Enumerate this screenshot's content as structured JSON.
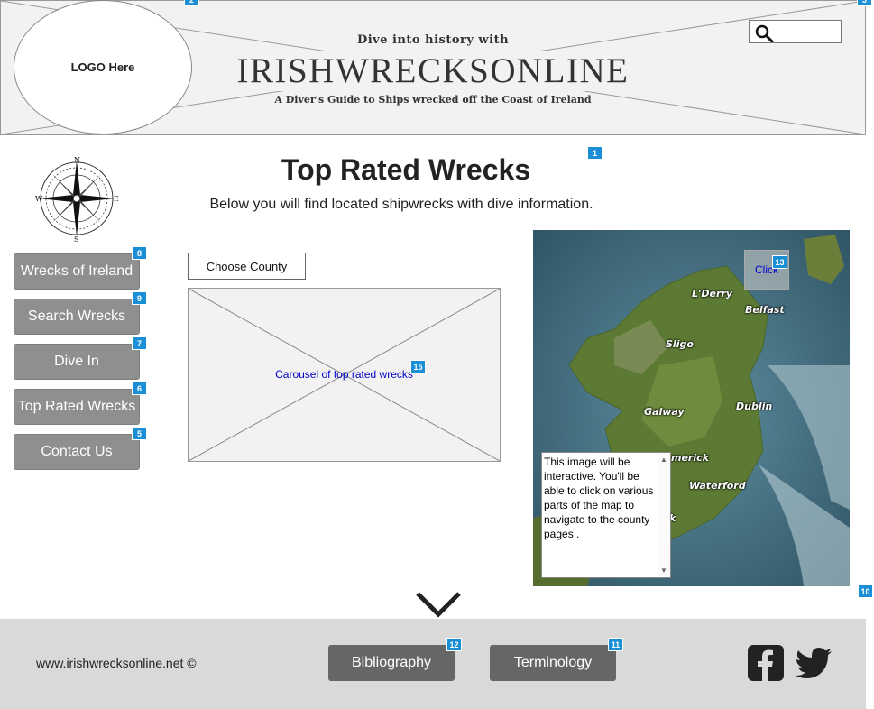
{
  "header": {
    "logo_text": "LOGO Here",
    "tagline_top": "Dive into history with",
    "site_title": "IRISHWRECKSONLINE",
    "tagline_bottom": "A Diver's Guide to Ships wrecked off the Coast of Ireland",
    "search_icon": "search-icon"
  },
  "badges": {
    "header_logo": "2",
    "header_search": "3",
    "title": "1",
    "nav_wrecks": "8",
    "nav_search": "9",
    "nav_dive": "7",
    "nav_top": "6",
    "nav_contact": "5",
    "map_click": "13",
    "carousel": "15",
    "map_corner": "10",
    "bibliography": "12",
    "terminology": "11"
  },
  "main": {
    "title": "Top Rated Wrecks",
    "subtitle": "Below you will find located shipwrecks with dive information.",
    "choose_county": "Choose County",
    "carousel_label": "Carousel of top rated wrecks"
  },
  "sidebar": {
    "logo_icon": "compass-rose-icon",
    "items": [
      {
        "label": "Wrecks of Ireland"
      },
      {
        "label": "Search Wrecks"
      },
      {
        "label": "Dive In"
      },
      {
        "label": "Top Rated Wrecks"
      },
      {
        "label": "Contact Us"
      }
    ]
  },
  "map": {
    "click_label": "Click",
    "labels": {
      "derry": "L'Derry",
      "belfast": "Belfast",
      "sligo": "Sligo",
      "galway": "Galway",
      "dublin": "Dublin",
      "limerick": "merick",
      "waterford": "Waterford",
      "cork": "k"
    },
    "note": "This image will be interactive.  You'll be able to click on various parts of the map to navigate to the county pages ."
  },
  "footer": {
    "copyright": "www.irishwrecksonline.net ©",
    "bibliography": "Bibliography",
    "terminology": "Terminology",
    "social_icons": [
      "facebook-icon",
      "twitter-icon"
    ]
  },
  "colors": {
    "badge": "#1a8fd6",
    "nav_button": "#8f8f8f",
    "footer_button": "#666666",
    "footer_bg": "#d9d9d9",
    "link_blue": "#0000cc"
  }
}
